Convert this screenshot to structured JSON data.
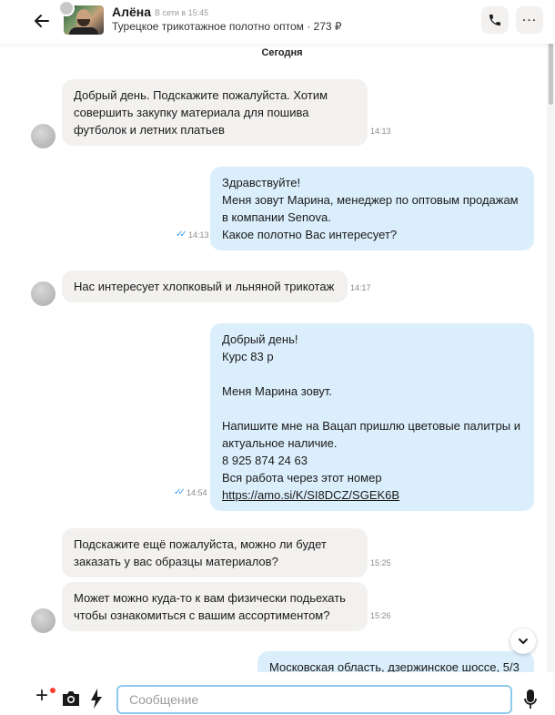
{
  "header": {
    "contact_name": "Алёна",
    "status": "В сети в 15:45",
    "listing": "Турецкое трикотажное полотно оптом · 273 ₽"
  },
  "date_separator": "Сегодня",
  "messages": [
    {
      "side": "in",
      "lines": [
        "Добрый день. Подскажите пожалуйста. Хотим",
        "совершить закупку материала для пошива",
        "футболок и летних платьев"
      ],
      "time": "14:13"
    },
    {
      "side": "out",
      "lines": [
        "Здравствуйте!",
        "Меня зовут Марина, менеджер по оптовым продажам",
        "в компании Senova.",
        "Какое полотно Вас интересует?"
      ],
      "time": "14:13"
    },
    {
      "side": "in",
      "lines": [
        "Нас интересует хлопковый и льняной трикотаж"
      ],
      "time": "14:17"
    },
    {
      "side": "out",
      "lines": [
        "Добрый день!",
        "Курс 83 р",
        "",
        "Меня Марина зовут.",
        "",
        "Напишите мне на Вацап пришлю цветовые палитры и",
        "актуальное наличие.",
        "8 925 874 24 63",
        "Вся работа через этот номер"
      ],
      "link": "https://amo.si/K/SI8DCZ/SGEK6B",
      "time": "14:54"
    },
    {
      "side": "in",
      "lines": [
        "Подскажите ещё пожалуйста, можно ли будет",
        "заказать у вас образцы материалов?"
      ],
      "time": "15:25"
    },
    {
      "side": "in",
      "lines": [
        "Может можно куда-то к вам физически подьехать",
        "чтобы ознакомиться с вашим ассортиментом?"
      ],
      "time": "15:26"
    },
    {
      "side": "out",
      "lines": [
        "Московская область, дзержинское шоссе, 5/3"
      ],
      "time": ""
    }
  ],
  "composer": {
    "placeholder": "Сообщение"
  },
  "colors": {
    "incoming_bubble": "#f2f1ef",
    "outgoing_bubble": "#dbeefc",
    "read_ticks": "#3d9be9",
    "input_border": "#8ec8ec",
    "notification_dot": "#ff3b30"
  },
  "icons": [
    "back-arrow-icon",
    "phone-icon",
    "more-icon",
    "chevron-down-icon",
    "plus-icon",
    "camera-icon",
    "lightning-icon",
    "microphone-icon",
    "double-check-icon"
  ]
}
